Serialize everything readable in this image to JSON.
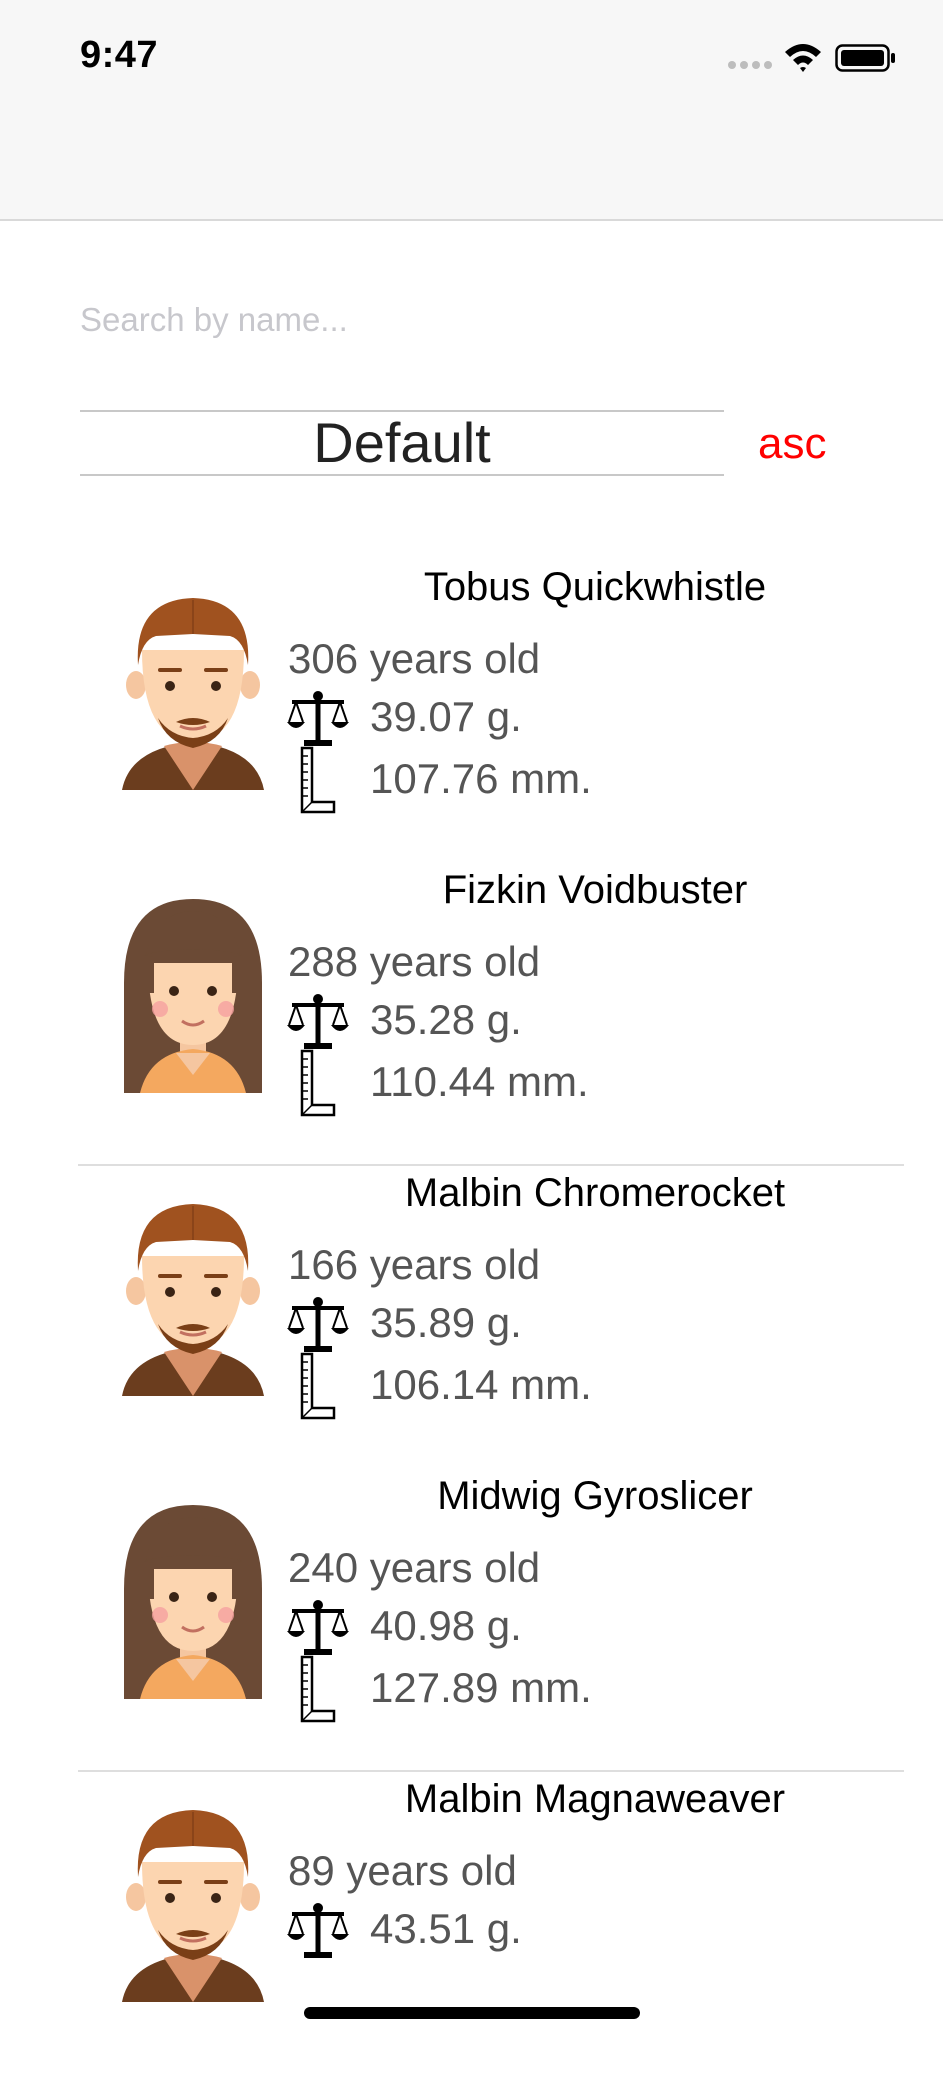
{
  "status": {
    "time": "9:47"
  },
  "search": {
    "placeholder": "Search by name..."
  },
  "sort": {
    "field": "Default",
    "order": "asc"
  },
  "people": [
    {
      "name": "Tobus Quickwhistle",
      "age": "306 years old",
      "weight": "39.07 g.",
      "height": "107.76 mm.",
      "avatar": "male"
    },
    {
      "name": "Fizkin Voidbuster",
      "age": "288 years old",
      "weight": "35.28 g.",
      "height": "110.44 mm.",
      "avatar": "female"
    },
    {
      "name": "Malbin Chromerocket",
      "age": "166 years old",
      "weight": "35.89 g.",
      "height": "106.14 mm.",
      "avatar": "male"
    },
    {
      "name": "Midwig Gyroslicer",
      "age": "240 years old",
      "weight": "40.98 g.",
      "height": "127.89 mm.",
      "avatar": "female"
    },
    {
      "name": "Malbin Magnaweaver",
      "age": "89 years old",
      "weight": "43.51 g.",
      "height": "",
      "avatar": "male"
    }
  ],
  "icons": {
    "weight": "scale-icon",
    "height": "ruler-icon"
  }
}
